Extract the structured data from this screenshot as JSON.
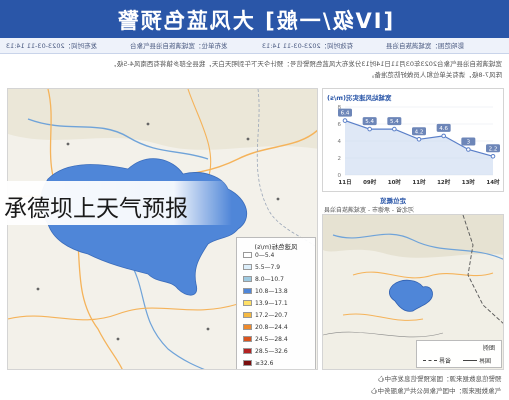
{
  "header": {
    "title": "[IV级/一般] 大风蓝色预警",
    "meta": [
      "发布时间：2023-03-11 14:13",
      "发布单位：宽城满族自治县气象台",
      "有效时间：2023-03-11 14:13",
      "影响范围：宽城满族自治县"
    ]
  },
  "paragraphs": [
    "宽城满族自治县气象台2023年03月11日14时13分发布大风蓝色预警信号：预计今天下午到明天白天，我县全部乡镇将有西南风4-5级，",
    "阵风7-8级，请有关单位和人员做好防范准备。"
  ],
  "map": {
    "legend_title": "风速色标(m/s)",
    "legend_items": [
      {
        "label": "0—5.4",
        "color": "#ffffff"
      },
      {
        "label": "5.5—7.9",
        "color": "#dceefa"
      },
      {
        "label": "8.0—10.7",
        "color": "#9ecae1"
      },
      {
        "label": "10.8—13.8",
        "color": "#4f86d8"
      },
      {
        "label": "13.9—17.1",
        "color": "#ffe066"
      },
      {
        "label": "17.2—20.7",
        "color": "#f5b942"
      },
      {
        "label": "20.8—24.4",
        "color": "#ee8a2c"
      },
      {
        "label": "24.5—28.4",
        "color": "#d9531e"
      },
      {
        "label": "28.5—32.6",
        "color": "#b22222"
      },
      {
        "label": "≥32.6",
        "color": "#7a0d0d"
      }
    ]
  },
  "chart_data": {
    "type": "line",
    "title": "宽城站风速实况(m/s)",
    "categories": [
      "11日",
      "09时",
      "10时",
      "11时",
      "12时",
      "13时",
      "14时"
    ],
    "values": [
      6.4,
      5.4,
      5.4,
      4.2,
      4.6,
      3.0,
      2.2
    ],
    "ylim": [
      0,
      8
    ]
  },
  "location": {
    "heading": "定位概览",
    "subtitle": "河北省 - 承德市 - 宽城满族自治县",
    "legend_title": "图例",
    "legend_items": [
      {
        "label": "省界",
        "color": "#444444"
      },
      {
        "label": "国界",
        "color": "#444444"
      }
    ]
  },
  "footer": {
    "line1": "预警信息数据来源：国家预警信息发布中心",
    "line2": "气象数据来源：中国气象局公共气象服务中心"
  },
  "overlay": {
    "text": "承德坝上天气预报"
  },
  "colors": {
    "header_bg": "#2a56a8",
    "warning_area": "#4f86d8",
    "river": "#6fa3d9",
    "road": "#f5b35a"
  }
}
